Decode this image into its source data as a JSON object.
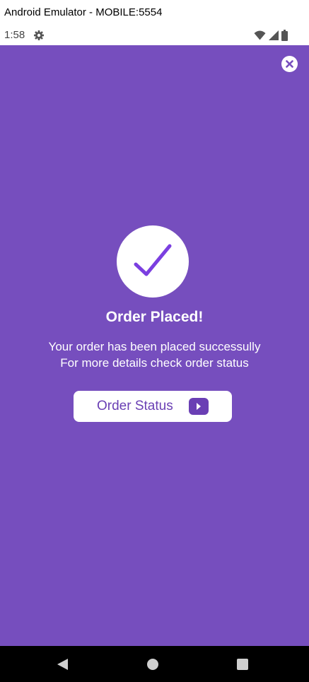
{
  "window": {
    "title": "Android Emulator - MOBILE:5554"
  },
  "status_bar": {
    "time": "1:58",
    "icons": [
      "gear-icon",
      "wifi-icon",
      "signal-icon",
      "battery-icon"
    ]
  },
  "colors": {
    "background": "#764ebe",
    "accent": "#6a3fb4",
    "checkmark": "#7b3fe0",
    "text": "#ffffff"
  },
  "screen": {
    "close_icon": "close-icon",
    "success_icon": "checkmark-icon",
    "title": "Order Placed!",
    "message_line_1": "Your order has been placed successully",
    "message_line_2": "For more details check order status",
    "order_status_button": {
      "label": "Order Status",
      "icon": "play-arrow-icon"
    }
  },
  "nav_bar": {
    "icons": [
      "back-icon",
      "home-icon",
      "recents-icon"
    ]
  }
}
